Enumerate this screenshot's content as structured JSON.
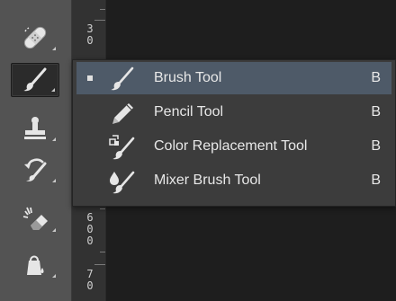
{
  "toolbar": {
    "tools": [
      {
        "name": "healing-brush-tool",
        "icon": "bandage-icon",
        "active": false
      },
      {
        "name": "brush-tool",
        "icon": "brush-icon",
        "active": true
      },
      {
        "name": "clone-stamp-tool",
        "icon": "stamp-icon",
        "active": false
      },
      {
        "name": "history-brush-tool",
        "icon": "history-brush-icon",
        "active": false
      },
      {
        "name": "eraser-tool",
        "icon": "eraser-icon",
        "active": false
      },
      {
        "name": "paint-bucket-tool",
        "icon": "paint-bucket-icon",
        "active": false
      }
    ]
  },
  "ruler": {
    "labels": [
      "3",
      "0",
      "6",
      "0",
      "0",
      "7",
      "0"
    ]
  },
  "flyout": {
    "items": [
      {
        "label": "Brush Tool",
        "shortcut": "B",
        "icon": "brush-icon",
        "selected": true
      },
      {
        "label": "Pencil Tool",
        "shortcut": "B",
        "icon": "pencil-icon",
        "selected": false
      },
      {
        "label": "Color Replacement Tool",
        "shortcut": "B",
        "icon": "color-replacement-icon",
        "selected": false
      },
      {
        "label": "Mixer Brush Tool",
        "shortcut": "B",
        "icon": "mixer-brush-icon",
        "selected": false
      }
    ]
  },
  "colors": {
    "panel": "#535353",
    "flyout_bg": "#3c3c3c",
    "selection": "#4e5a68",
    "text": "#e8e8e8"
  }
}
